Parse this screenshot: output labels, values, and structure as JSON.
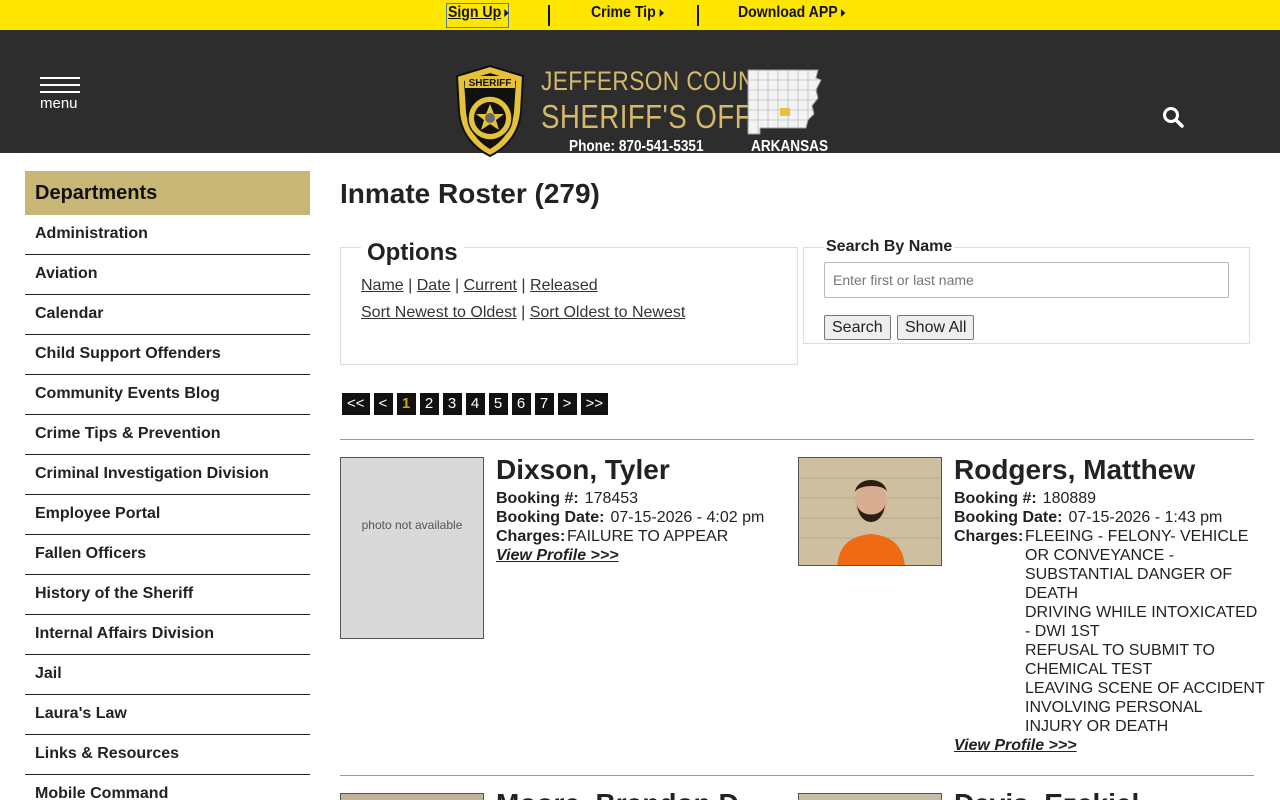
{
  "topbar": {
    "signup": "Sign Up",
    "crime_tip": "Crime Tip",
    "download_app": "Download APP"
  },
  "header": {
    "menu_label": "menu",
    "title_line1": "JEFFERSON COUNTY",
    "title_line2": "SHERIFF'S OFFICE",
    "phone": "Phone: 870-541-5351",
    "state": "ARKANSAS",
    "badge_top": "SHERIFF",
    "badge_sub": "JEFFERSON",
    "colors": {
      "bar": "#ffe600",
      "header_bg": "#2d2d2d",
      "gold": "#d4b96a"
    }
  },
  "sidebar": {
    "heading": "Departments",
    "items": [
      {
        "label": "Administration"
      },
      {
        "label": "Aviation"
      },
      {
        "label": "Calendar"
      },
      {
        "label": "Child Support Offenders"
      },
      {
        "label": "Community Events Blog"
      },
      {
        "label": "Crime Tips & Prevention"
      },
      {
        "label": "Criminal Investigation Division"
      },
      {
        "label": "Employee Portal"
      },
      {
        "label": "Fallen Officers"
      },
      {
        "label": "History of the Sheriff"
      },
      {
        "label": "Internal Affairs Division"
      },
      {
        "label": "Jail"
      },
      {
        "label": "Laura's Law"
      },
      {
        "label": "Links & Resources"
      },
      {
        "label": "Mobile Command"
      }
    ]
  },
  "main": {
    "title": "Inmate Roster (279)",
    "options": {
      "legend": "Options",
      "name": "Name",
      "date": "Date",
      "current": "Current",
      "released": "Released",
      "newest": "Sort Newest to Oldest",
      "oldest": "Sort Oldest to Newest",
      "sep": "|"
    },
    "search": {
      "label": "Search By Name",
      "placeholder": "Enter first or last name",
      "value": "",
      "search_button": "Search",
      "show_all_button": "Show All"
    },
    "pager": [
      "<<",
      "<",
      "1",
      "2",
      "3",
      "4",
      "5",
      "6",
      "7",
      ">",
      ">>"
    ],
    "current_page": "1"
  },
  "labels": {
    "booking_number": "Booking #:",
    "booking_date": "Booking Date:",
    "charges": "Charges:",
    "view_profile": "View Profile >>>",
    "photo_na": "photo not available"
  },
  "inmates": [
    {
      "name": "Dixson, Tyler",
      "booking_number": "178453",
      "booking_date": "07-15-2026 - 4:02 pm",
      "charges": [
        "FAILURE TO APPEAR"
      ]
    },
    {
      "name": "Rodgers, Matthew",
      "booking_number": "180889",
      "booking_date": "07-15-2026 - 1:43 pm",
      "charges": [
        "FLEEING - FELONY- VEHICLE",
        "OR CONVEYANCE -",
        "SUBSTANTIAL DANGER OF",
        "DEATH",
        "DRIVING WHILE INTOXICATED",
        "- DWI 1ST",
        "REFUSAL TO SUBMIT TO",
        "CHEMICAL TEST",
        "LEAVING SCENE OF ACCIDENT",
        "INVOLVING PERSONAL",
        "INJURY OR DEATH"
      ]
    },
    {
      "name": "Moore, Brandon D"
    },
    {
      "name": "Davis, Ezekiel"
    }
  ]
}
